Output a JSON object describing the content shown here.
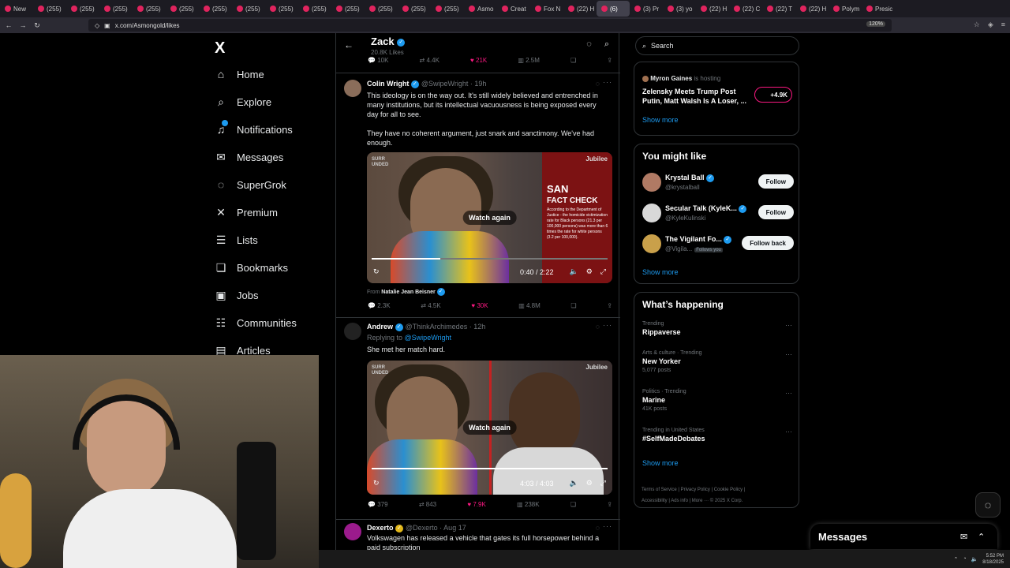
{
  "browser": {
    "tabs": [
      {
        "label": "New",
        "active": false
      },
      {
        "label": "(255)",
        "active": false
      },
      {
        "label": "(255)",
        "active": false
      },
      {
        "label": "(255)",
        "active": false
      },
      {
        "label": "(255)",
        "active": false
      },
      {
        "label": "(255)",
        "active": false
      },
      {
        "label": "(255)",
        "active": false
      },
      {
        "label": "(255)",
        "active": false
      },
      {
        "label": "(255)",
        "active": false
      },
      {
        "label": "(255)",
        "active": false
      },
      {
        "label": "(255)",
        "active": false
      },
      {
        "label": "(255)",
        "active": false
      },
      {
        "label": "(255)",
        "active": false
      },
      {
        "label": "(255)",
        "active": false
      },
      {
        "label": "Asmo",
        "active": false
      },
      {
        "label": "Creat",
        "active": false
      },
      {
        "label": "Fox N",
        "active": false
      },
      {
        "label": "(22) H",
        "active": false
      },
      {
        "label": "(6)",
        "active": true
      },
      {
        "label": "(3) Pr",
        "active": false
      },
      {
        "label": "(3) yo",
        "active": false
      },
      {
        "label": "(22) H",
        "active": false
      },
      {
        "label": "(22) C",
        "active": false
      },
      {
        "label": "(22) T",
        "active": false
      },
      {
        "label": "(22) H",
        "active": false
      },
      {
        "label": "Polym",
        "active": false
      },
      {
        "label": "Presic",
        "active": false
      }
    ],
    "url": "x.com/Asmongold/likes",
    "zoom": "120%"
  },
  "nav": {
    "logo": "X",
    "items": [
      {
        "label": "Home",
        "icon": "⌂"
      },
      {
        "label": "Explore",
        "icon": "⌕"
      },
      {
        "label": "Notifications",
        "icon": "♫"
      },
      {
        "label": "Messages",
        "icon": "✉"
      },
      {
        "label": "SuperGrok",
        "icon": "◌"
      },
      {
        "label": "Premium",
        "icon": "✕"
      },
      {
        "label": "Lists",
        "icon": "☰"
      },
      {
        "label": "Bookmarks",
        "icon": "❏"
      },
      {
        "label": "Jobs",
        "icon": "▣"
      },
      {
        "label": "Communities",
        "icon": "☷"
      },
      {
        "label": "Articles",
        "icon": "▤"
      }
    ]
  },
  "header": {
    "name": "Zack",
    "sub": "20.8K Likes"
  },
  "top_actions": {
    "replies": "10K",
    "reposts": "4.4K",
    "likes": "21K",
    "views": "2.5M"
  },
  "tweets": [
    {
      "name": "Colin Wright",
      "handle": "@SwipeWright · 19h",
      "text1": "This ideology is on the way out. It's still widely believed and entrenched in many institutions, but its intellectual vacuousness is being exposed every day for all to see.",
      "text2": "They have no coherent argument, just snark and sanctimony. We've had enough.",
      "video": {
        "watch": "Watch again",
        "time": "0:40 / 2:22",
        "progress": 0.29,
        "jubilee": "Jubilee",
        "surr": "SURR\nUNDED",
        "san": "SAN\nFACT CHECK",
        "fact": "According to the Department of Justice - the homicide victimization rate for Black persons (21.3 per 100,000 persons) was more than 6 times the rate for white persons (3.2 per 100,000)."
      },
      "from_prefix": "From",
      "from_name": "Natalie Jean Beisner",
      "actions": {
        "replies": "2.3K",
        "reposts": "4.5K",
        "likes": "30K",
        "views": "4.8M"
      }
    },
    {
      "name": "Andrew",
      "handle": "@ThinkArchimedes · 12h",
      "replying_prefix": "Replying to",
      "replying_to": "@SwipeWright",
      "text1": "She met her match hard.",
      "video": {
        "watch": "Watch again",
        "time": "4:03 / 4:03",
        "progress": 1.0,
        "jubilee": "Jubilee",
        "surr": "SURR\nUNDED"
      },
      "actions": {
        "replies": "379",
        "reposts": "843",
        "likes": "7.9K",
        "views": "238K"
      }
    },
    {
      "name": "Dexerto",
      "handle": "@Dexerto · Aug 17",
      "text1": "Volkswagen has released a vehicle that gates its full horsepower behind a paid subscription"
    }
  ],
  "right": {
    "search_placeholder": "Search",
    "spaces": {
      "host": "Myron Gaines",
      "host_suffix": "is hosting",
      "title": "Zelensky Meets Trump Post Putin, Matt Walsh Is A Loser, ...",
      "listeners": "+4.9K",
      "show_more": "Show more"
    },
    "suggest": {
      "title": "You might like",
      "people": [
        {
          "name": "Krystal Ball",
          "handle": "@krystalball",
          "button": "Follow",
          "follows_you": ""
        },
        {
          "name": "Secular Talk (KyleK...",
          "handle": "@KyleKulinski",
          "button": "Follow",
          "follows_you": ""
        },
        {
          "name": "The Vigilant Fo...",
          "handle": "@Vigila...",
          "button": "Follow back",
          "follows_you": "Follows you"
        }
      ],
      "show_more": "Show more"
    },
    "happening": {
      "title": "What’s happening",
      "trends": [
        {
          "context": "Trending",
          "title": "Rippaverse",
          "count": ""
        },
        {
          "context": "Arts & culture · Trending",
          "title": "New Yorker",
          "count": "5,077 posts"
        },
        {
          "context": "Politics · Trending",
          "title": "Marine",
          "count": "41K posts"
        },
        {
          "context": "Trending in United States",
          "title": "#SelfMadeDebates",
          "count": ""
        }
      ],
      "show_more": "Show more"
    },
    "footer": {
      "line1": "Terms of Service  |  Privacy Policy  |  Cookie Policy  |",
      "line2": "Accessibility  |  Ads info  |  More ···  © 2025 X Corp."
    }
  },
  "messages_bar": {
    "label": "Messages"
  },
  "taskbar": {
    "time": "5:52 PM",
    "date": "8/18/2025"
  }
}
